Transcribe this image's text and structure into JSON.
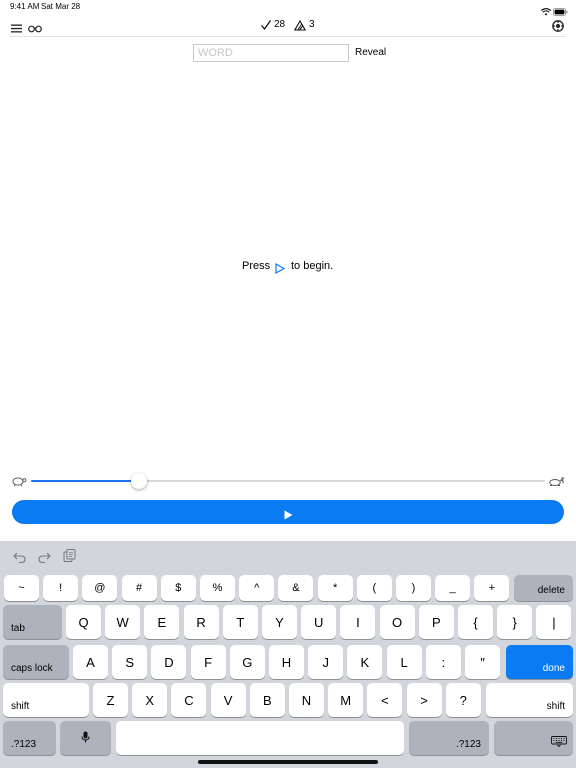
{
  "status_bar": {
    "time": "9:41 AM",
    "date": "Sat Mar 28"
  },
  "toolbar": {
    "check_count": "28",
    "warning_count": "3"
  },
  "input": {
    "placeholder": "WORD",
    "value": ""
  },
  "reveal_label": "Reveal",
  "message": {
    "before": "Press",
    "after": "to begin."
  },
  "speed_slider": {
    "value": 0.21
  },
  "colors": {
    "accent": "#0a7bf2",
    "keyboard_bg": "#d2d5db",
    "special_key": "#adb3bc"
  },
  "keyboard": {
    "row1": [
      "~",
      "!",
      "@",
      "#",
      "$",
      "%",
      "^",
      "&",
      "*",
      "(",
      ")",
      "_",
      "+"
    ],
    "delete": "delete",
    "tab": "tab",
    "row2": [
      "Q",
      "W",
      "E",
      "R",
      "T",
      "Y",
      "U",
      "I",
      "O",
      "P",
      "{",
      "}",
      "|"
    ],
    "caps_lock": "caps lock",
    "row3": [
      "A",
      "S",
      "D",
      "F",
      "G",
      "H",
      "J",
      "K",
      "L",
      ":",
      "″"
    ],
    "done": "done",
    "shift_left": "shift",
    "row4": [
      "Z",
      "X",
      "C",
      "V",
      "B",
      "N",
      "M",
      "<",
      ">",
      "?"
    ],
    "shift_right": "shift",
    "numbers_left": ".?123",
    "numbers_right": ".?123"
  }
}
